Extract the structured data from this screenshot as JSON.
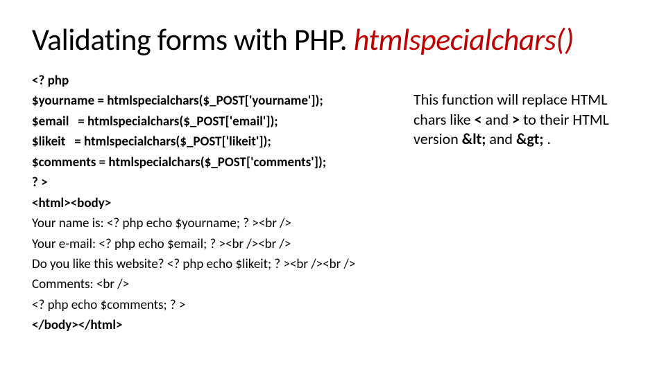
{
  "title": {
    "prefix": "Validating forms with PHP. ",
    "fn": "htmlspecialchars()"
  },
  "code": {
    "l1": "<? php",
    "l2": "$yourname = htmlspecialchars($_POST['yourname']);",
    "l3a": "$email",
    "l3b": "= htmlspecialchars($_POST['email']);",
    "l4a": "$likeit",
    "l4b": "= htmlspecialchars($_POST['likeit']);",
    "l5": "$comments = htmlspecialchars($_POST['comments']);",
    "l6": "? >",
    "l7": "<html><body>",
    "l8": "Your name is: <? php echo $yourname; ? ><br />",
    "l9": "Your e-mail: <? php echo $email; ? ><br /><br />",
    "l10": "Do you like this website? <? php echo $likeit; ? ><br /><br />",
    "l11": "Comments: <br />",
    "l12": "<? php echo $comments; ? >",
    "l13": "</body></html>"
  },
  "desc": {
    "t1": "This function will replace HTML chars like ",
    "lt": "<",
    "t2": " and ",
    "gt": ">",
    "t3": " to their HTML version ",
    "ampLt": "&lt;",
    "t4": " and ",
    "ampGt": "&gt;",
    "t5": " ."
  }
}
